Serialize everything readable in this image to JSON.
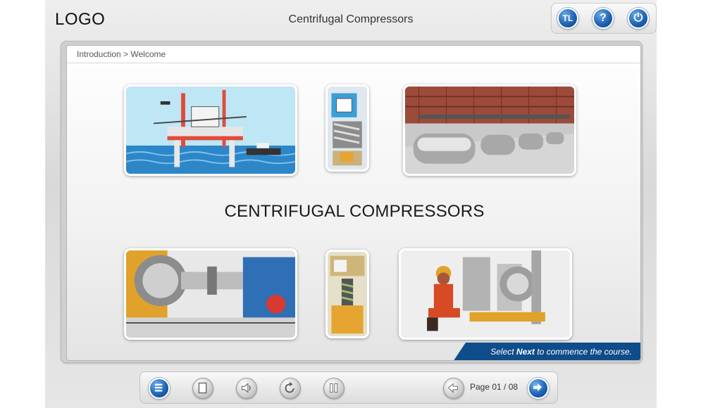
{
  "header": {
    "logo": "LOGO",
    "course_title": "Centrifugal Compressors",
    "buttons": [
      {
        "icon": "glossary-icon",
        "label": "TL"
      },
      {
        "icon": "help-icon",
        "label": "?"
      },
      {
        "icon": "power-icon",
        "label": "⏻"
      }
    ]
  },
  "breadcrumb": "Introduction > Welcome",
  "main": {
    "heading": "CENTRIFUGAL COMPRESSORS",
    "images": [
      "offshore-platform-image",
      "compressor-cutaway-image",
      "compressor-plant-image",
      "coupling-shaft-image",
      "seal-detail-image",
      "technician-image"
    ]
  },
  "banner": {
    "prefix": "Select ",
    "bold": "Next",
    "suffix": " to commence the course."
  },
  "footer": {
    "buttons": [
      "menu-icon",
      "document-icon",
      "audio-icon",
      "replay-icon",
      "pause-icon"
    ],
    "page_label": "Page 01 / 08",
    "prev_icon": "back-arrow-icon",
    "next_icon": "next-arrow-icon"
  },
  "colors": {
    "accent": "#1f64b3",
    "banner": "#0f4c8a",
    "frame": "#dcdcdc"
  }
}
